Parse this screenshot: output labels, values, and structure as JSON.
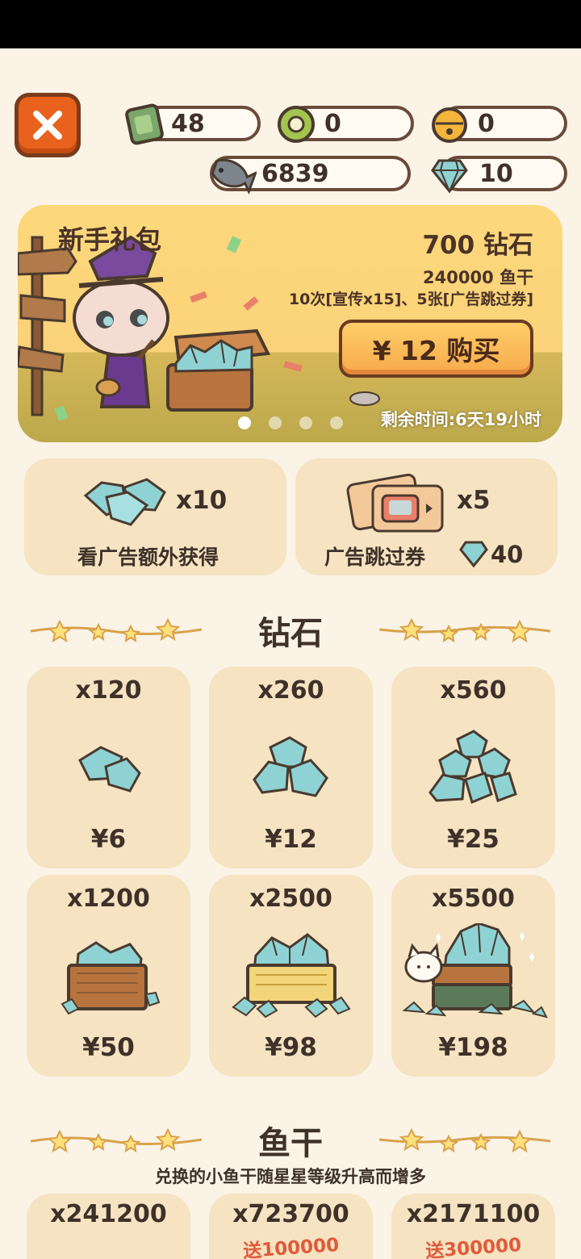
{
  "currencies": {
    "tickets": "48",
    "coins": "0",
    "bells": "0",
    "fish": "6839",
    "diamonds": "10"
  },
  "banner": {
    "title": "新手礼包",
    "reward_diamonds": "700 钻石",
    "reward_fish": "240000 鱼干",
    "reward_extra": "10次[宣传x15]、5张[广告跳过券]",
    "buy_label": "¥ 12 购买",
    "timer": "剩余时间:6天19小时"
  },
  "ad_cards": {
    "extra": {
      "count": "x10",
      "label": "看广告额外获得"
    },
    "skip": {
      "count": "x5",
      "label": "广告跳过券",
      "cost": "40"
    }
  },
  "diamond_section": {
    "title": "钻石",
    "items": [
      {
        "amount": "x120",
        "price": "¥6"
      },
      {
        "amount": "x260",
        "price": "¥12"
      },
      {
        "amount": "x560",
        "price": "¥25"
      },
      {
        "amount": "x1200",
        "price": "¥50"
      },
      {
        "amount": "x2500",
        "price": "¥98"
      },
      {
        "amount": "x5500",
        "price": "¥198"
      }
    ]
  },
  "fish_section": {
    "title": "鱼干",
    "subtitle": "兑换的小鱼干随星星等级升高而增多",
    "items": [
      {
        "amount": "x241200",
        "bonus": ""
      },
      {
        "amount": "x723700",
        "bonus": "送100000"
      },
      {
        "amount": "x2171100",
        "bonus": "送300000"
      }
    ]
  },
  "colors": {
    "background": "#faf3e6",
    "card": "#f5e3c2",
    "close_button": "#e8621d",
    "diamond": "#8fd2d4"
  }
}
